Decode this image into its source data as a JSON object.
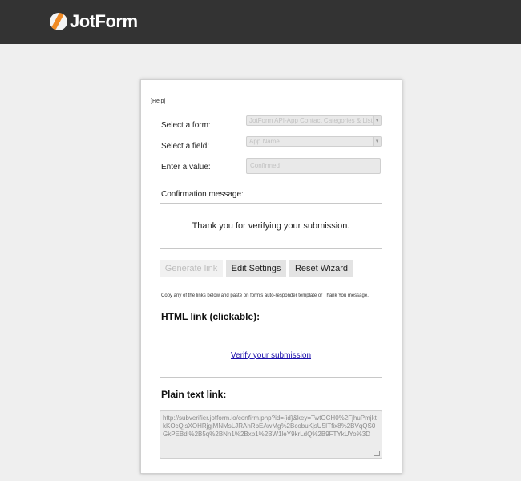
{
  "header": {
    "brand": "JotForm"
  },
  "panel": {
    "help": "[Help]",
    "select_form_label": "Select a form:",
    "select_form_value": "JotForm API-App Contact Categories & Lists",
    "select_field_label": "Select a field:",
    "select_field_value": "App Name",
    "value_label": "Enter a value:",
    "value_placeholder": "Confirmed",
    "confirmation_label": "Confirmation message:",
    "confirmation_message": "Thank you for verifying your submission.",
    "buttons": {
      "generate": "Generate link",
      "edit": "Edit Settings",
      "reset": "Reset Wizard"
    },
    "copy_note": "Copy any of the links below and paste on form's auto-responder template or Thank You message.",
    "html_link_heading": "HTML link (clickable):",
    "html_link_text": "Verify your submission",
    "plain_heading": "Plain text link:",
    "plain_url": "http://subverifier.jotform.io/confirm.php?id={id}&key=TwtOCH0%2FjhuPmjktkKOcQjsXOHRjgjMNMsLJRAhRbEAwMg%2BcobuKjsU5ITfix8%2BVqQS0GkPEBdi%2B5q%2BNn1%2Bxb1%2BW1leY9krLdQ%2B9FTYkUYo%3D"
  },
  "icons": {
    "logo": "jotform-logo-icon",
    "dropdown": "chevron-down-icon"
  }
}
